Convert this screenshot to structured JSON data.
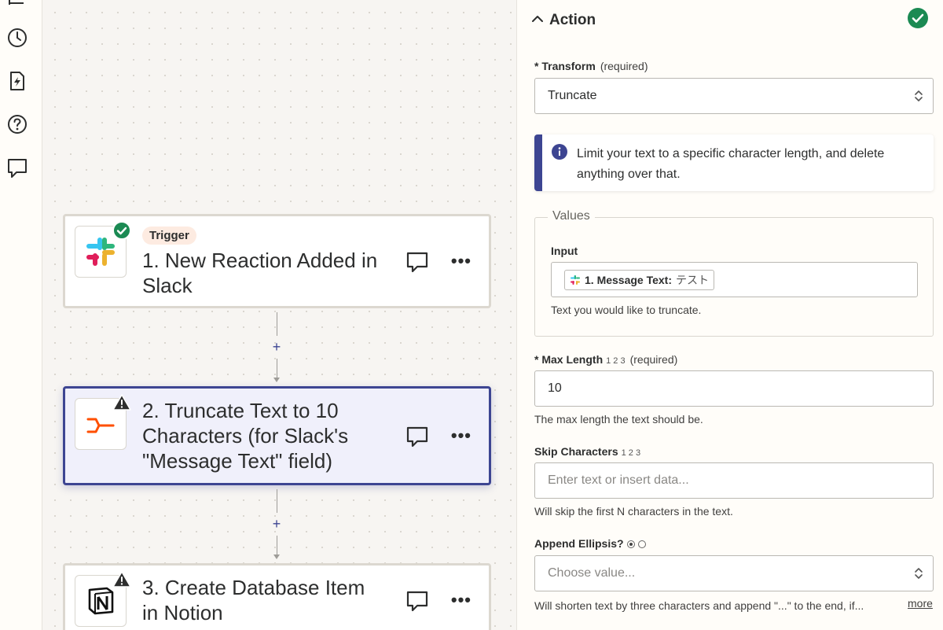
{
  "rail": {
    "icons": [
      "history-icon",
      "zap-file-icon",
      "help-icon",
      "comment-icon"
    ]
  },
  "steps": [
    {
      "pill": "Trigger",
      "title_line1": "1. New Reaction Added in",
      "title_line2": "Slack",
      "app_icon": "slack-icon",
      "status": "success"
    },
    {
      "title_line1": "2. Truncate Text to 10",
      "title_line2": "Characters (for Slack's",
      "title_line3": "\"Message Text\" field)",
      "app_icon": "formatter-icon",
      "status": "warning"
    },
    {
      "title_line1": "3. Create Database Item",
      "title_line2": "in Notion",
      "app_icon": "notion-icon",
      "status": "warning"
    }
  ],
  "connectors": {
    "plus_label": "+"
  },
  "panel": {
    "title": "Action",
    "transform": {
      "label": "* Transform",
      "required": "(required)",
      "value": "Truncate"
    },
    "info": "Limit your text to a specific character length, and delete anything over that.",
    "values_legend": "Values",
    "input": {
      "label": "Input",
      "chip_label": "1. Message Text:",
      "chip_value": "テスト",
      "help": "Text you would like to truncate."
    },
    "max_length": {
      "label": "* Max Length",
      "type_hint": "1 2 3",
      "required": "(required)",
      "value": "10",
      "help": "The max length the text should be."
    },
    "skip_characters": {
      "label": "Skip Characters",
      "type_hint": "1 2 3",
      "placeholder": "Enter text or insert data...",
      "help": "Will skip the first N characters in the text."
    },
    "append_ellipsis": {
      "label": "Append Ellipsis?",
      "placeholder": "Choose value...",
      "help": "Will shorten text by three characters and append \"...\" to the end, if...",
      "more": "more"
    }
  },
  "colors": {
    "accent": "#3d4592",
    "success": "#1b8a53",
    "border": "#bab8b3"
  }
}
